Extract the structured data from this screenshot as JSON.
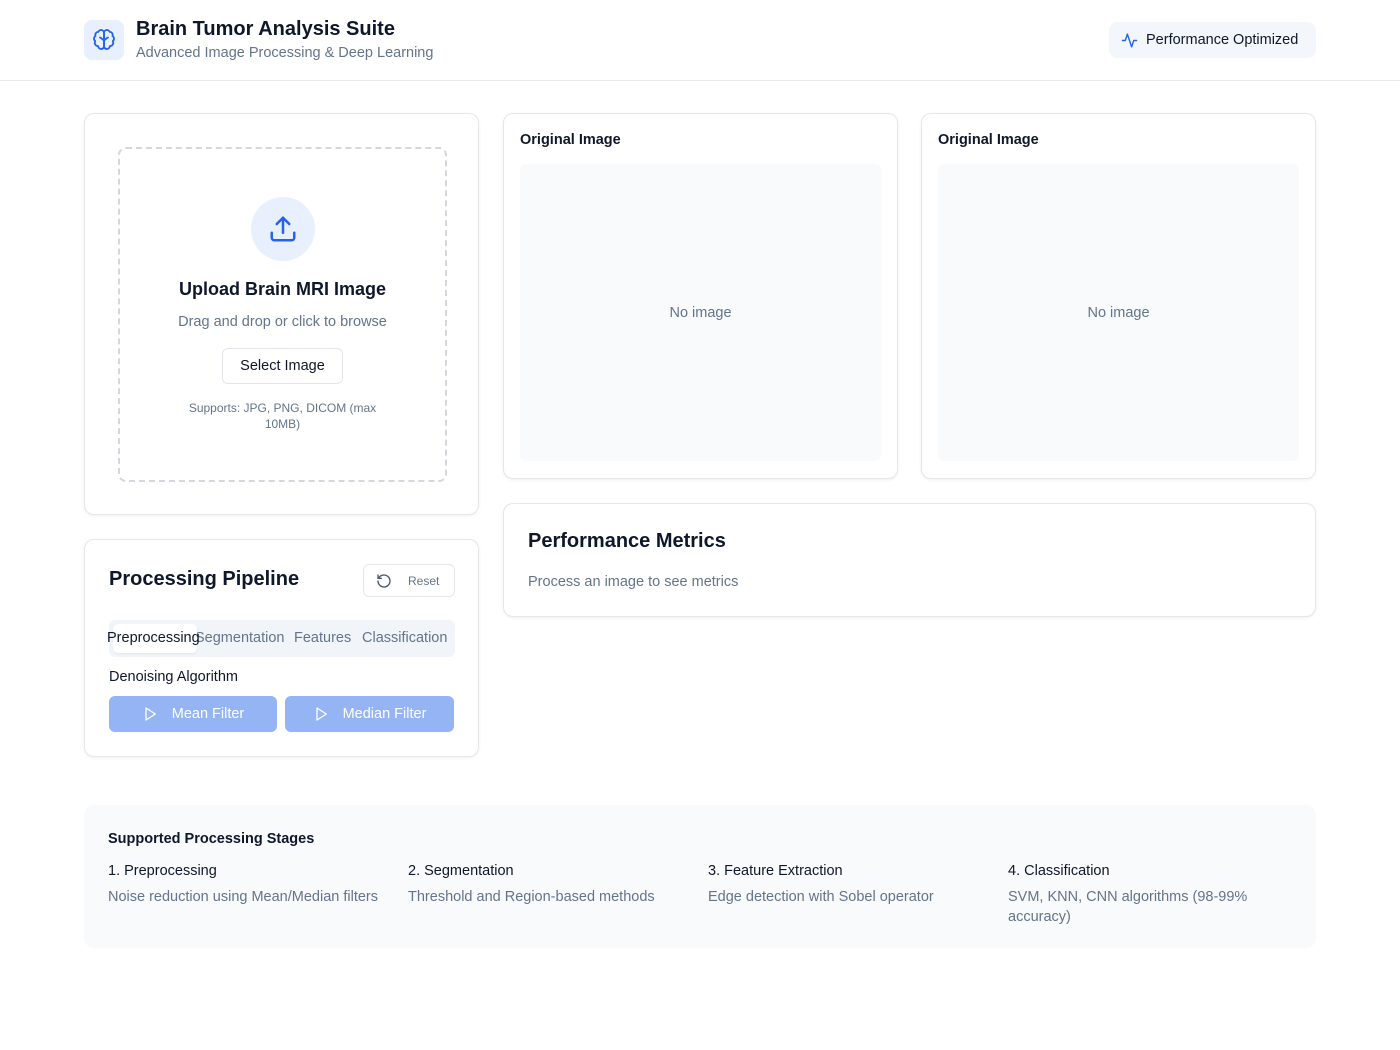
{
  "header": {
    "title": "Brain Tumor Analysis Suite",
    "subtitle": "Advanced Image Processing & Deep Learning",
    "badge_label": "Performance Optimized",
    "logo_icon": "brain-icon",
    "badge_icon": "activity-icon"
  },
  "upload": {
    "icon": "upload-icon",
    "title": "Upload Brain MRI Image",
    "subtitle": "Drag and drop or click to browse",
    "button_label": "Select Image",
    "supports": "Supports: JPG, PNG, DICOM (max 10MB)"
  },
  "image_panels": [
    {
      "title": "Original Image",
      "placeholder": "No image"
    },
    {
      "title": "Original Image",
      "placeholder": "No image"
    }
  ],
  "metrics": {
    "title": "Performance Metrics",
    "subtitle": "Process an image to see metrics"
  },
  "pipeline": {
    "title": "Processing Pipeline",
    "reset_label": "Reset",
    "reset_icon": "rotate-ccw-icon",
    "tabs": [
      {
        "label": "Preprocessing",
        "active": true
      },
      {
        "label": "Segmentation",
        "active": false
      },
      {
        "label": "Features",
        "active": false
      },
      {
        "label": "Classification",
        "active": false
      }
    ],
    "section_label": "Denoising Algorithm",
    "buttons": [
      {
        "label": "Mean Filter",
        "icon": "play-icon"
      },
      {
        "label": "Median Filter",
        "icon": "play-icon"
      }
    ]
  },
  "stages": {
    "title": "Supported Processing Stages",
    "items": [
      {
        "name": "1. Preprocessing",
        "description": "Noise reduction using Mean/Median filters"
      },
      {
        "name": "2. Segmentation",
        "description": "Threshold and Region-based methods"
      },
      {
        "name": "3. Feature Extraction",
        "description": "Edge detection with Sobel operator"
      },
      {
        "name": "4. Classification",
        "description": "SVM, KNN, CNN algorithms (98-99% accuracy)"
      }
    ]
  },
  "colors": {
    "accent": "#2563eb",
    "accent_light": "#e8f0fe",
    "button_disabled": "#94b4f3",
    "muted_text": "#64748b"
  }
}
